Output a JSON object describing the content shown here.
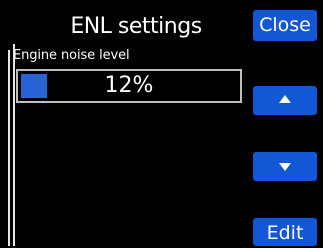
{
  "header": {
    "title": "ENL settings"
  },
  "field": {
    "label": "Engine noise level",
    "value_text": "12%",
    "value_fraction": 0.12
  },
  "buttons": {
    "close_label": "Close",
    "up_icon": "arrow-up-icon",
    "down_icon": "arrow-down-icon",
    "edit_label": "Edit"
  },
  "colors": {
    "background": "#000000",
    "button": "#1457d6",
    "level_fill": "#2a62d8",
    "text": "#ffffff"
  }
}
